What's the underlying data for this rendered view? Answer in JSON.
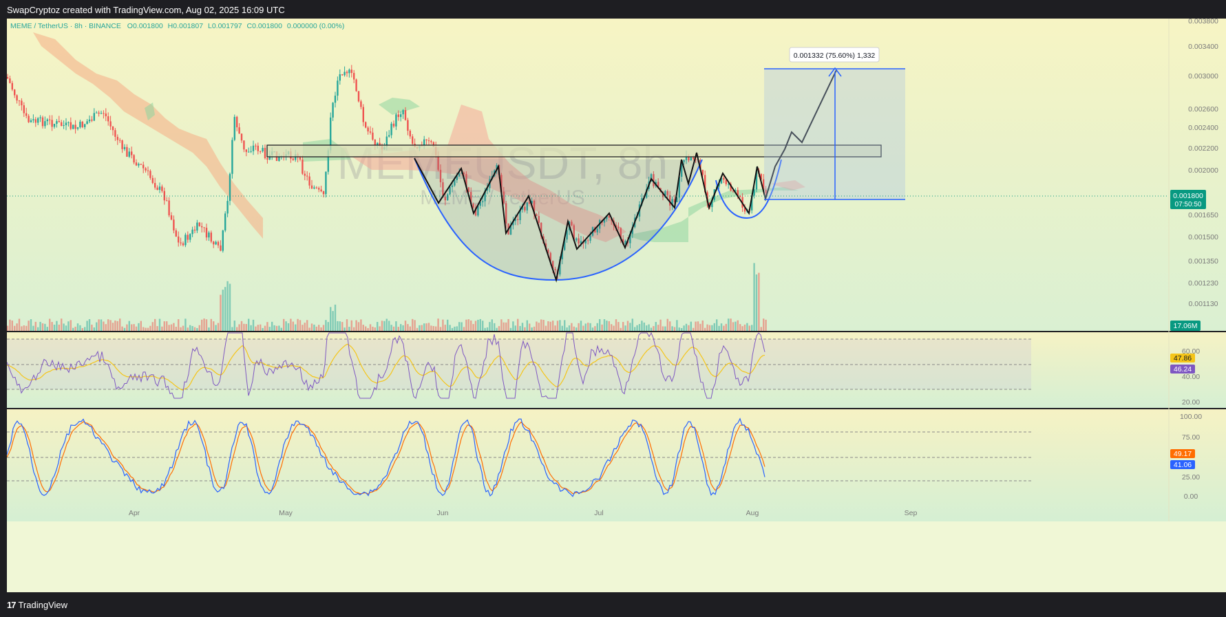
{
  "header": {
    "attribution": "SwapCryptoz created with TradingView.com, Aug 02, 2025 16:09 UTC"
  },
  "legend": {
    "symbol": "MEME / TetherUS · 8h · BINANCE",
    "o_label": "O",
    "o_value": "0.001800",
    "h_label": "H",
    "h_value": "0.001807",
    "l_label": "L",
    "l_value": "0.001797",
    "c_label": "C",
    "c_value": "0.001800",
    "change": "0.000000 (0.00%)"
  },
  "watermark": {
    "main": "MEMEUSDT, 8h",
    "sub": "MEME / TetherUS"
  },
  "price_axis": {
    "ticks": [
      "0.003800",
      "0.003400",
      "0.003000",
      "0.002600",
      "0.002400",
      "0.002200",
      "0.002000",
      "0.001650",
      "0.001500",
      "0.001350",
      "0.001230",
      "0.001130"
    ],
    "current_price": "0.001800",
    "countdown": "07:50:50",
    "volume_label": "17.06M"
  },
  "projection_label": "0.001332 (75.60%) 1,332",
  "rsi": {
    "ticks": [
      "60.00",
      "40.00",
      "20.00"
    ],
    "ma_value": "47.86",
    "rsi_value": "46.24"
  },
  "stoch": {
    "ticks": [
      "100.00",
      "75.00",
      "25.00",
      "0.00"
    ],
    "d_value": "49.17",
    "k_value": "41.06"
  },
  "time_axis": [
    "Apr",
    "May",
    "Jun",
    "Jul",
    "Aug",
    "Sep"
  ],
  "footer": {
    "brand": "TradingView"
  },
  "colors": {
    "up": "#26a69a",
    "down": "#ef5350",
    "pattern_line": "#2962ff",
    "rsi": "#7e57c2",
    "rsi_ma": "#f5c518",
    "stoch_k": "#2962ff",
    "stoch_d": "#ff6d00",
    "price_badge": "#089981"
  }
}
